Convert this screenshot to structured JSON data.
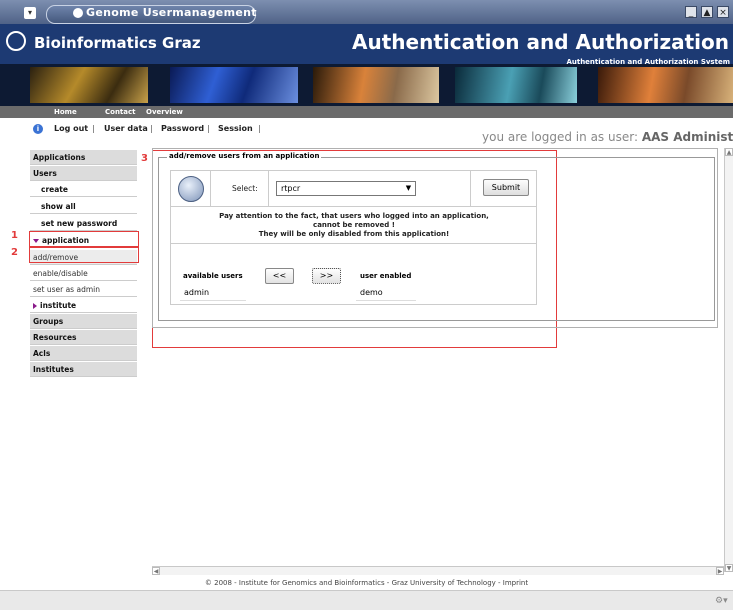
{
  "window": {
    "title": "Genome Usermanagement"
  },
  "header": {
    "brand": "Bioinformatics Graz",
    "heading": "Authentication and Authorization",
    "subheading": "Authentication and Authorization System"
  },
  "nav": {
    "items": [
      "Home",
      "Contact",
      "Overview"
    ]
  },
  "sublinks": {
    "items": [
      "Log out",
      "User data",
      "Password",
      "Session"
    ]
  },
  "login": {
    "prefix": "you are logged in as user: ",
    "user": "AAS Administrator"
  },
  "sidebar": {
    "applications": "Applications",
    "users": "Users",
    "create": "create",
    "show_all": "show all",
    "set_new_password": "set new password",
    "application": "application",
    "add_remove": "add/remove",
    "enable_disable": "enable/disable",
    "set_user_as_admin": "set user as admin",
    "institute": "institute",
    "groups": "Groups",
    "resources": "Resources",
    "acls": "Acls",
    "institutes": "Institutes"
  },
  "annotations": {
    "n1": "1",
    "n2": "2",
    "n3": "3"
  },
  "form": {
    "legend": "add/remove users from an application",
    "select_label": "Select:",
    "selected_app": "rtpcr",
    "submit": "Submit",
    "warning_line1": "Pay attention to the fact, that users who logged into an application,",
    "warning_line2": "cannot be removed !",
    "warning_line3": "They will be only disabled from this application!",
    "available_header": "available users",
    "available_users": [
      "admin"
    ],
    "enabled_header": "user enabled",
    "enabled_users": [
      "demo"
    ],
    "move_left": "<<",
    "move_right": ">>"
  },
  "footer": {
    "text": "© 2008 - Institute for Genomics and Bioinformatics - Graz University of Technology - Imprint"
  },
  "colors": {
    "header_bg": "#1d3a73",
    "annotation": "#e23b3b",
    "nav_bg": "#6b6b6b"
  }
}
